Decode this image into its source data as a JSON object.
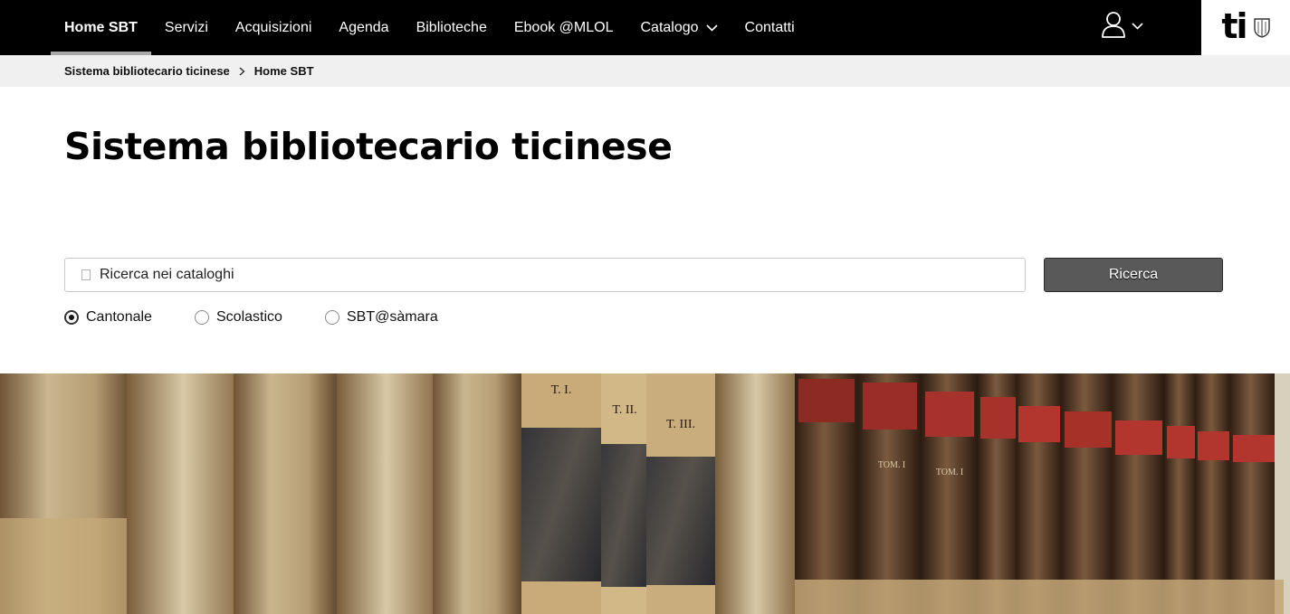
{
  "nav": {
    "items": [
      {
        "label": "Home SBT",
        "active": true
      },
      {
        "label": "Servizi"
      },
      {
        "label": "Acquisizioni"
      },
      {
        "label": "Agenda"
      },
      {
        "label": "Biblioteche"
      },
      {
        "label": "Ebook @MLOL"
      },
      {
        "label": "Catalogo",
        "has_dropdown": true
      },
      {
        "label": "Contatti"
      }
    ],
    "user_icon": "user-icon",
    "logo": {
      "text": "ti",
      "icon": "shield-icon"
    }
  },
  "breadcrumb": {
    "items": [
      "Sistema bibliotecario ticinese",
      "Home SBT"
    ]
  },
  "page": {
    "title": "Sistema bibliotecario ticinese"
  },
  "search": {
    "placeholder": "Ricerca nei cataloghi",
    "value": "",
    "button_label": "Ricerca",
    "options": [
      {
        "label": "Cantonale",
        "checked": true
      },
      {
        "label": "Scolastico",
        "checked": false
      },
      {
        "label": "SBT@sàmara",
        "checked": false
      }
    ]
  },
  "hero": {
    "labels": [
      "T. I.",
      "T. II.",
      "T. III.",
      "TOM. I",
      "TOM. I"
    ]
  },
  "colors": {
    "nav_bg": "#000000",
    "breadcrumb_bg": "#f0f0f0",
    "button_bg": "#595959",
    "active_underline": "#a9a9a9"
  }
}
